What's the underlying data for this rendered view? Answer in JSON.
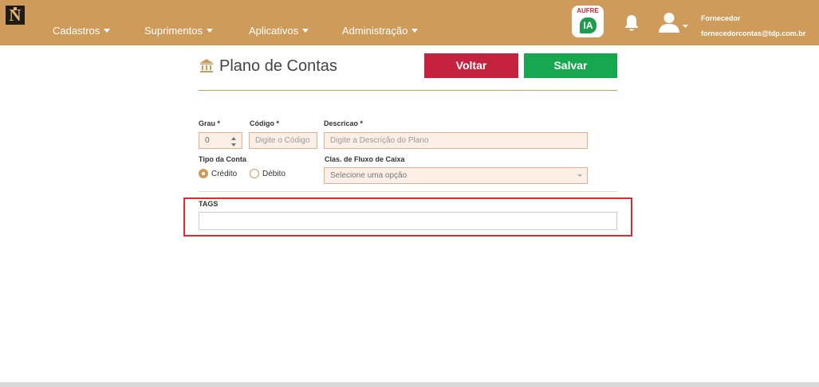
{
  "app": {
    "logo_text": "N"
  },
  "navbar": {
    "menus": [
      {
        "label": "Cadastros"
      },
      {
        "label": "Suprimentos"
      },
      {
        "label": "Aplicativos"
      },
      {
        "label": "Administração"
      }
    ],
    "aufre": {
      "top": "AUFRE",
      "badge": "IA"
    },
    "user": {
      "name": "Fornecedor",
      "email": "fornecedorcontas@tdp.com.br"
    }
  },
  "page": {
    "title": "Plano de Contas",
    "back_label": "Voltar",
    "save_label": "Salvar"
  },
  "form": {
    "grau": {
      "label": "Grau *",
      "value": "0"
    },
    "codigo": {
      "label": "Código *",
      "placeholder": "Digite o Código"
    },
    "descricao": {
      "label": "Descricao *",
      "placeholder": "Digite a Descrição do Plano"
    },
    "tipo_conta": {
      "label": "Tipo da Conta",
      "options": [
        "Crédito",
        "Débito"
      ],
      "selected": "Crédito"
    },
    "fluxo_caixa": {
      "label": "Clas. de Fluxo de Caixa",
      "placeholder": "Selecione uma opção"
    },
    "tags": {
      "label": "TAGS",
      "value": ""
    }
  },
  "colors": {
    "brand": "#cf9b5a",
    "back": "#c4223f",
    "save": "#17a84f",
    "highlight": "#df2b2b"
  }
}
